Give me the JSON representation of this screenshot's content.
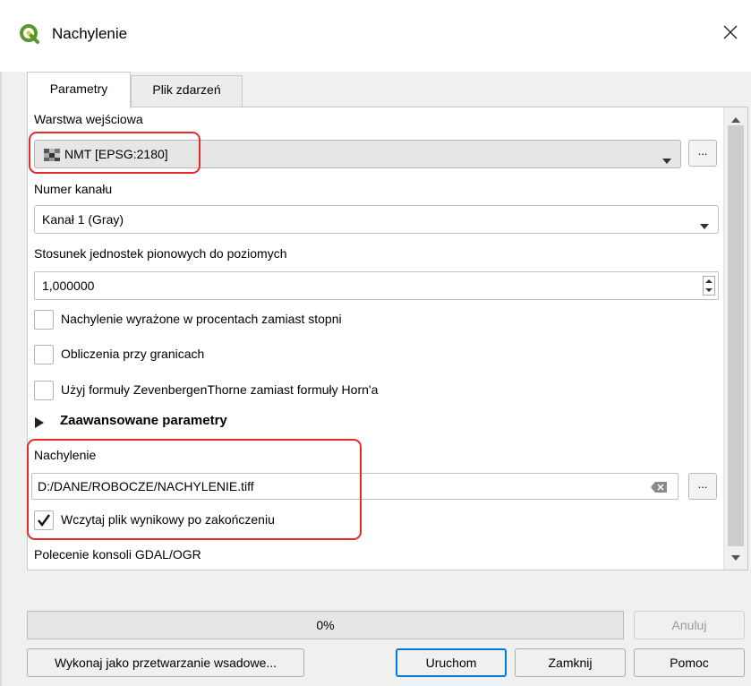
{
  "window": {
    "title": "Nachylenie",
    "app_icon": "qgis-icon",
    "close_label": "X"
  },
  "tabs": [
    {
      "label": "Parametry",
      "active": true
    },
    {
      "label": "Plik zdarzeń",
      "active": false
    }
  ],
  "params": {
    "input_layer": {
      "label": "Warstwa wejściowa",
      "value": "NMT [EPSG:2180]",
      "icon": "raster-layer-icon",
      "browse_label": "..."
    },
    "band": {
      "label": "Numer kanału",
      "value": "Kanał 1 (Gray)"
    },
    "scale": {
      "label": "Stosunek jednostek pionowych do poziomych",
      "value": "1,000000"
    },
    "checkboxes": [
      {
        "label": "Nachylenie wyrażone w procentach zamiast stopni",
        "checked": false
      },
      {
        "label": "Obliczenia przy granicach",
        "checked": false
      },
      {
        "label": "Użyj formuły ZevenbergenThorne zamiast formuły Horn'a",
        "checked": false
      }
    ],
    "advanced_label": "Zaawansowane parametry",
    "output": {
      "label": "Nachylenie",
      "value": "D:/DANE/ROBOCZE/NACHYLENIE.tiff",
      "browse_label": "...",
      "load_label": "Wczytaj plik wynikowy po zakończeniu",
      "load_checked": true
    },
    "console_label": "Polecenie konsoli GDAL/OGR"
  },
  "progress": {
    "text": "0%",
    "value": 0
  },
  "buttons": {
    "cancel": "Anuluj",
    "batch": "Wykonaj jako przetwarzanie wsadowe...",
    "run": "Uruchom",
    "close": "Zamknij",
    "help": "Pomoc"
  },
  "colors": {
    "highlight": "#e52a2a",
    "qgis_green": "#589632",
    "default_button_border": "#0078d7"
  }
}
